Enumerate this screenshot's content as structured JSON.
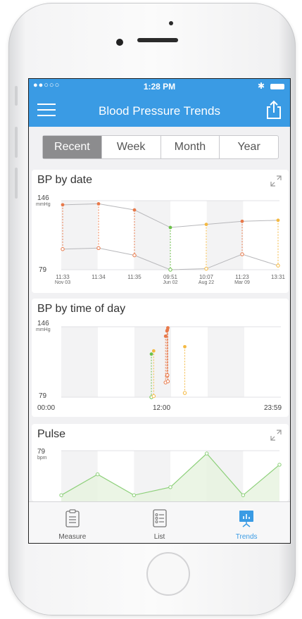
{
  "status": {
    "carrier": "●●○○○",
    "time": "1:28 PM",
    "bluetooth": "✱"
  },
  "nav": {
    "title": "Blood Pressure Trends",
    "menu_icon": "hamburger-icon",
    "share_icon": "share-icon"
  },
  "segments": {
    "items": [
      "Recent",
      "Week",
      "Month",
      "Year"
    ],
    "selected": "Recent"
  },
  "cards": {
    "by_date": {
      "title": "BP by date"
    },
    "by_time": {
      "title": "BP by time of day"
    },
    "pulse": {
      "title": "Pulse"
    }
  },
  "tabs": [
    {
      "label": "Measure",
      "icon": "clipboard-icon"
    },
    {
      "label": "List",
      "icon": "list-icon"
    },
    {
      "label": "Trends",
      "icon": "chart-board-icon",
      "active": true
    }
  ],
  "colors": {
    "accent": "#3a9be4",
    "high": "#e8794a",
    "normal": "#6cc24a",
    "elevated": "#f4b942",
    "pulse": "#8dd07a"
  },
  "chart_data": [
    {
      "type": "line",
      "title": "BP by date",
      "y_top_label": "146",
      "y_unit": "mmHg",
      "y_bottom_label": "79",
      "ylim": [
        79,
        146
      ],
      "x_labels": [
        {
          "time": "11:33",
          "date": "Nov 03"
        },
        {
          "time": "11:34",
          "date": ""
        },
        {
          "time": "11:35",
          "date": ""
        },
        {
          "time": "09:51",
          "date": "Jun 02"
        },
        {
          "time": "10:07",
          "date": "Aug 22"
        },
        {
          "time": "11:23",
          "date": "Mar 09"
        },
        {
          "time": "13:31",
          "date": ""
        }
      ],
      "series": [
        {
          "values": [
            142,
            143,
            137,
            120,
            123,
            126,
            127
          ]
        },
        {
          "values": [
            99,
            100,
            93,
            79,
            80,
            94,
            83
          ]
        }
      ],
      "point_colors": [
        "#e8794a",
        "#e8794a",
        "#e8794a",
        "#6cc24a",
        "#f4b942",
        "#e8794a",
        "#f4b942"
      ]
    },
    {
      "type": "scatter",
      "title": "BP by time of day",
      "y_top_label": "146",
      "y_unit": "mmHg",
      "y_bottom_label": "79",
      "ylim": [
        79,
        146
      ],
      "xlim": [
        0,
        24
      ],
      "x_tick_labels": [
        "00:00",
        "12:00",
        "23:59"
      ],
      "readings": [
        {
          "hour": 9.85,
          "sys": 120,
          "dia": 79,
          "color": "#6cc24a"
        },
        {
          "hour": 10.1,
          "sys": 123,
          "dia": 80,
          "color": "#f4b942"
        },
        {
          "hour": 11.4,
          "sys": 137,
          "dia": 93,
          "color": "#e8794a"
        },
        {
          "hour": 11.55,
          "sys": 142,
          "dia": 99,
          "color": "#e8794a"
        },
        {
          "hour": 11.6,
          "sys": 143,
          "dia": 100,
          "color": "#e8794a"
        },
        {
          "hour": 11.65,
          "sys": 145,
          "dia": 94,
          "color": "#e8794a"
        },
        {
          "hour": 13.5,
          "sys": 127,
          "dia": 83,
          "color": "#f4b942"
        }
      ]
    },
    {
      "type": "area",
      "title": "Pulse",
      "y_top_label": "79",
      "y_unit": "bpm",
      "ylim": [
        50,
        79
      ],
      "values": [
        53,
        66,
        53,
        58,
        79,
        53,
        72
      ]
    }
  ]
}
